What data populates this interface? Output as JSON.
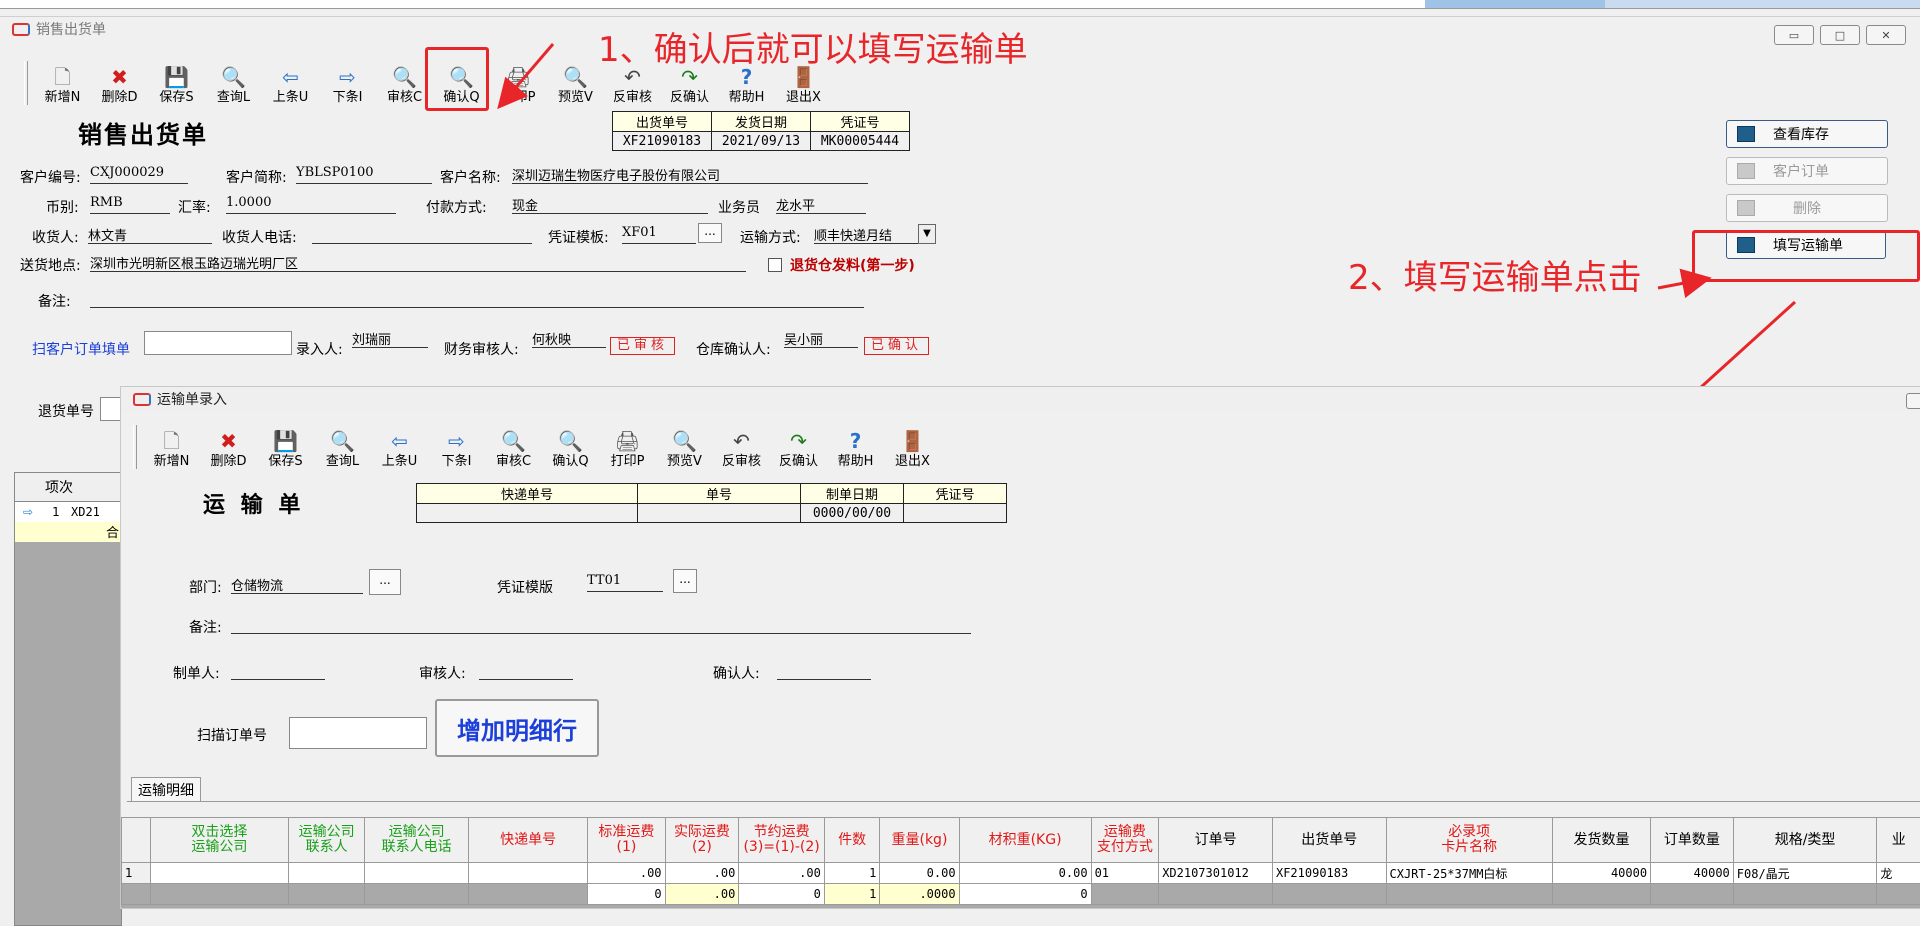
{
  "colors": {
    "annotation": "#e8262a",
    "stamp": "#d22222"
  },
  "main_window": {
    "title": "销售出货单",
    "toolbar": [
      {
        "label": "新增N",
        "icon": "new-doc-icon"
      },
      {
        "label": "删除D",
        "icon": "delete-x-icon"
      },
      {
        "label": "保存S",
        "icon": "floppy-icon"
      },
      {
        "label": "查询L",
        "icon": "doc-search-icon"
      },
      {
        "label": "上条U",
        "icon": "arrow-left-icon"
      },
      {
        "label": "下条I",
        "icon": "arrow-right-icon"
      },
      {
        "label": "审核C",
        "icon": "magnifier-icon"
      },
      {
        "label": "确认Q",
        "icon": "magnifier-icon"
      },
      {
        "label": "打印P",
        "icon": "printer-icon"
      },
      {
        "label": "预览V",
        "icon": "magnifier-icon"
      },
      {
        "label": "反审核",
        "icon": "unaudit-icon"
      },
      {
        "label": "反确认",
        "icon": "unconfirm-icon"
      },
      {
        "label": "帮助H",
        "icon": "help-icon"
      },
      {
        "label": "退出X",
        "icon": "exit-door-icon"
      }
    ],
    "form_title": "销售出货单",
    "header_table": {
      "headers": [
        "出货单号",
        "发货日期",
        "凭证号"
      ],
      "values": [
        "XF21090183",
        "2021/09/13",
        "MK00005444"
      ]
    },
    "fields": {
      "customer_code_label": "客户编号:",
      "customer_code": "CXJ000029",
      "customer_short_label": "客户简称:",
      "customer_short": "YBLSP0100",
      "customer_name_label": "客户名称:",
      "customer_name": "深圳迈瑞生物医疗电子股份有限公司",
      "currency_label": "币别:",
      "currency": "RMB",
      "rate_label": "汇率:",
      "rate": "1.0000",
      "payment_label": "付款方式:",
      "payment": "现金",
      "salesman_label": "业务员",
      "salesman": "龙水平",
      "receiver_label": "收货人:",
      "receiver": "林文青",
      "receiver_phone_label": "收货人电话:",
      "receiver_phone": "",
      "voucher_template_label": "凭证模板:",
      "voucher_template": "XF01",
      "shipping_method_label": "运输方式:",
      "shipping_method": "顺丰快递月结",
      "delivery_address_label": "送货地点:",
      "delivery_address": "深圳市光明新区根玉路迈瑞光明厂区",
      "return_material_label": "退货仓发料(第一步)",
      "remarks_label": "备注:",
      "scan_order_label": "扫客户订单填单",
      "entered_by_label": "录入人:",
      "entered_by": "刘瑞丽",
      "finance_label": "财务审核人:",
      "finance": "何秋映",
      "finance_stamp": "已审核",
      "warehouse_label": "仓库确认人:",
      "warehouse": "吴小丽",
      "warehouse_stamp": "已确认",
      "return_no_label": "退货单号"
    },
    "side_buttons": [
      "查看库存",
      "客户订单",
      "删除",
      "填写运输单"
    ],
    "left_grid": {
      "col_label": "项次",
      "row_no": "1",
      "row_val": "XD21",
      "footer": "合"
    }
  },
  "annotations": {
    "note1": "1、确认后就可以填写运输单",
    "note2": "2、填写运输单点击"
  },
  "dialog": {
    "title": "运输单录入",
    "toolbar": [
      {
        "label": "新增N",
        "icon": "new-doc-icon"
      },
      {
        "label": "删除D",
        "icon": "delete-x-icon"
      },
      {
        "label": "保存S",
        "icon": "floppy-icon"
      },
      {
        "label": "查询L",
        "icon": "doc-search-icon"
      },
      {
        "label": "上条U",
        "icon": "arrow-left-icon"
      },
      {
        "label": "下条I",
        "icon": "arrow-right-icon"
      },
      {
        "label": "审核C",
        "icon": "magnifier-icon"
      },
      {
        "label": "确认Q",
        "icon": "magnifier-icon"
      },
      {
        "label": "打印P",
        "icon": "printer-icon"
      },
      {
        "label": "预览V",
        "icon": "magnifier-icon"
      },
      {
        "label": "反审核",
        "icon": "unaudit-icon"
      },
      {
        "label": "反确认",
        "icon": "unconfirm-icon"
      },
      {
        "label": "帮助H",
        "icon": "help-icon"
      },
      {
        "label": "退出X",
        "icon": "exit-door-icon"
      }
    ],
    "form_title": "运 输 单",
    "header_table": {
      "headers": [
        "快递单号",
        "单号",
        "制单日期",
        "凭证号"
      ],
      "values": [
        "",
        "",
        "0000/00/00",
        ""
      ]
    },
    "fields": {
      "department_label": "部门:",
      "department": "仓储物流",
      "voucher_template_label": "凭证模版",
      "voucher_template": "TT01",
      "remarks_label": "备注:",
      "maker_label": "制单人:",
      "auditor_label": "审核人:",
      "confirmer_label": "确认人:",
      "scan_order_label": "扫描订单号"
    },
    "add_row_button": "增加明细行",
    "tab_label": "运输明细",
    "grid_headers": [
      {
        "l1": "双击选择",
        "l2": "运输公司",
        "color": "green"
      },
      {
        "l1": "运输公司",
        "l2": "联系人",
        "color": "green"
      },
      {
        "l1": "运输公司",
        "l2": "联系人电话",
        "color": "green"
      },
      {
        "l1": "快递单号",
        "l2": "",
        "color": "red"
      },
      {
        "l1": "标准运费",
        "l2": "(1)",
        "color": "red"
      },
      {
        "l1": "实际运费",
        "l2": "(2)",
        "color": "red"
      },
      {
        "l1": "节约运费",
        "l2": "(3)=(1)-(2)",
        "color": "red"
      },
      {
        "l1": "件数",
        "l2": "",
        "color": "red"
      },
      {
        "l1": "重量(kg)",
        "l2": "",
        "color": "red"
      },
      {
        "l1": "材积重(KG)",
        "l2": "",
        "color": "red"
      },
      {
        "l1": "运输费",
        "l2": "支付方式",
        "color": "red"
      },
      {
        "l1": "订单号",
        "l2": "",
        "color": "black"
      },
      {
        "l1": "出货单号",
        "l2": "",
        "color": "black"
      },
      {
        "l1": "必录项",
        "l2": "卡片名称",
        "color": "red"
      },
      {
        "l1": "发货数量",
        "l2": "",
        "color": "black"
      },
      {
        "l1": "订单数量",
        "l2": "",
        "color": "black"
      },
      {
        "l1": "规格/类型",
        "l2": "",
        "color": "black"
      },
      {
        "l1": "业",
        "l2": "",
        "color": "black"
      }
    ],
    "grid_row": {
      "no": "1",
      "cells": [
        "",
        "",
        "",
        "",
        ".00",
        ".00",
        ".00",
        "1",
        "0.00",
        "0.00",
        "01",
        "XD2107301012",
        "XF21090183",
        "CXJRT-25*37MM白标",
        "40000",
        "40000",
        "F08/晶元",
        "龙"
      ]
    },
    "grid_total": {
      "cells": [
        "",
        "",
        "",
        "",
        "0",
        ".00",
        "0",
        "1",
        ".0000",
        "0",
        "",
        "",
        "",
        "",
        "",
        "",
        "",
        ""
      ]
    }
  }
}
